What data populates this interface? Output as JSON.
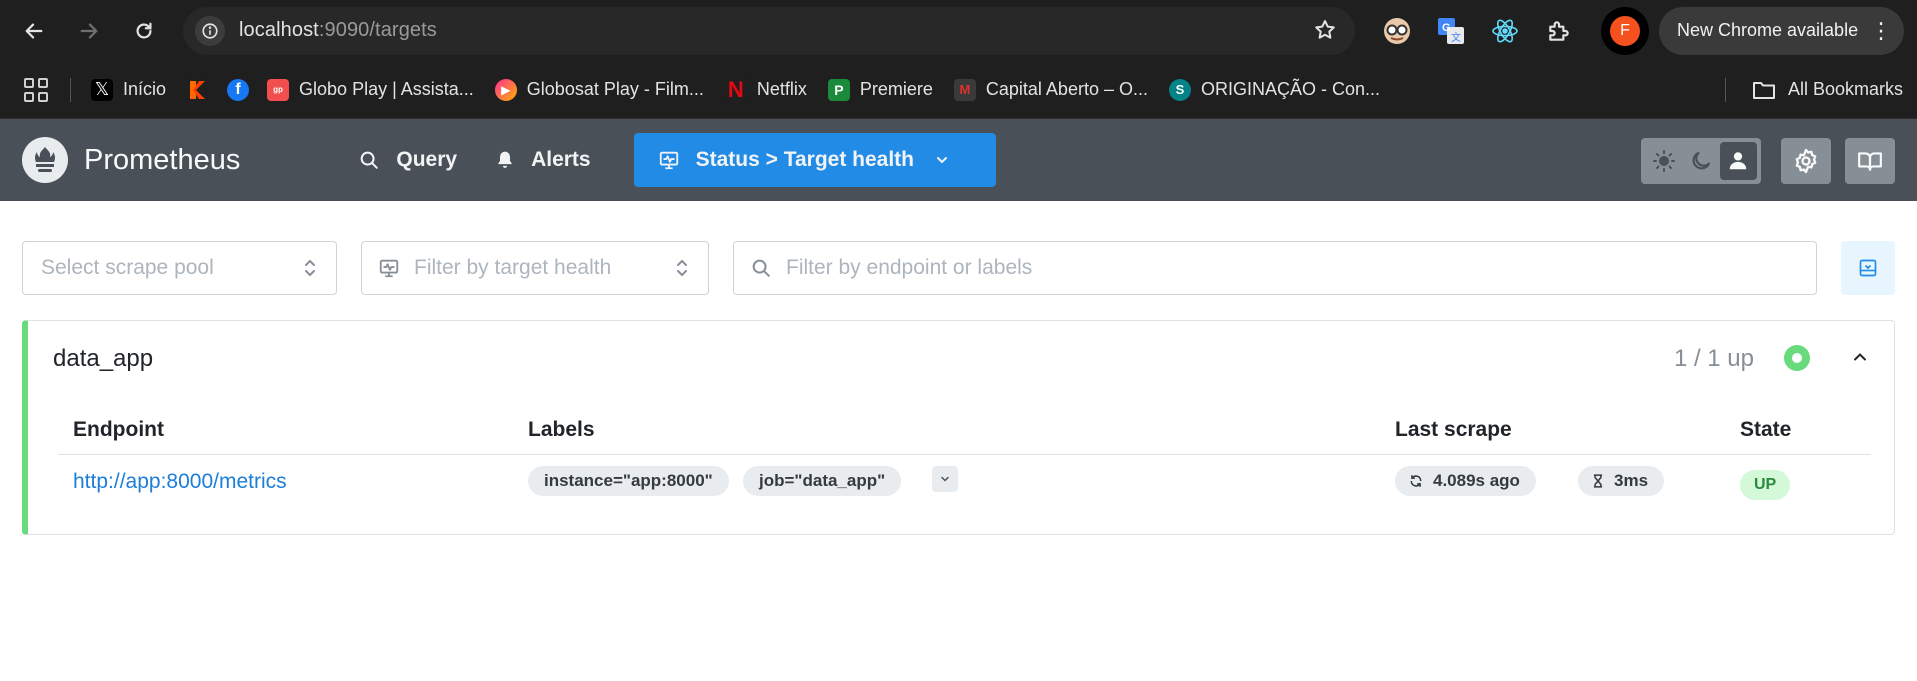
{
  "browser": {
    "url_host": "localhost",
    "url_rest": ":9090/targets",
    "profile_initial": "F",
    "update_label": "New Chrome available",
    "bookmarks": [
      {
        "label": "Início"
      },
      {
        "label": ""
      },
      {
        "label": ""
      },
      {
        "label": "Globo Play | Assista..."
      },
      {
        "label": "Globosat Play - Film..."
      },
      {
        "label": "Netflix"
      },
      {
        "label": "Premiere"
      },
      {
        "label": "Capital Aberto – O..."
      },
      {
        "label": "ORIGINAÇÃO - Con..."
      }
    ],
    "all_bookmarks_label": "All Bookmarks"
  },
  "header": {
    "brand": "Prometheus",
    "nav": {
      "query": "Query",
      "alerts": "Alerts",
      "status": "Status > Target health"
    }
  },
  "filters": {
    "scrape_pool_placeholder": "Select scrape pool",
    "health_placeholder": "Filter by target health",
    "search_placeholder": "Filter by endpoint or labels"
  },
  "pool": {
    "name": "data_app",
    "count": "1 / 1 up",
    "columns": {
      "endpoint": "Endpoint",
      "labels": "Labels",
      "last_scrape": "Last scrape",
      "state": "State"
    },
    "rows": [
      {
        "endpoint": "http://app:8000/metrics",
        "labels": [
          "instance=\"app:8000\"",
          "job=\"data_app\""
        ],
        "last_scrape": "4.089s ago",
        "duration": "3ms",
        "state": "UP"
      }
    ]
  },
  "colors": {
    "header_bg": "#495057",
    "accent": "#228be6",
    "up_green": "#69db7c"
  }
}
